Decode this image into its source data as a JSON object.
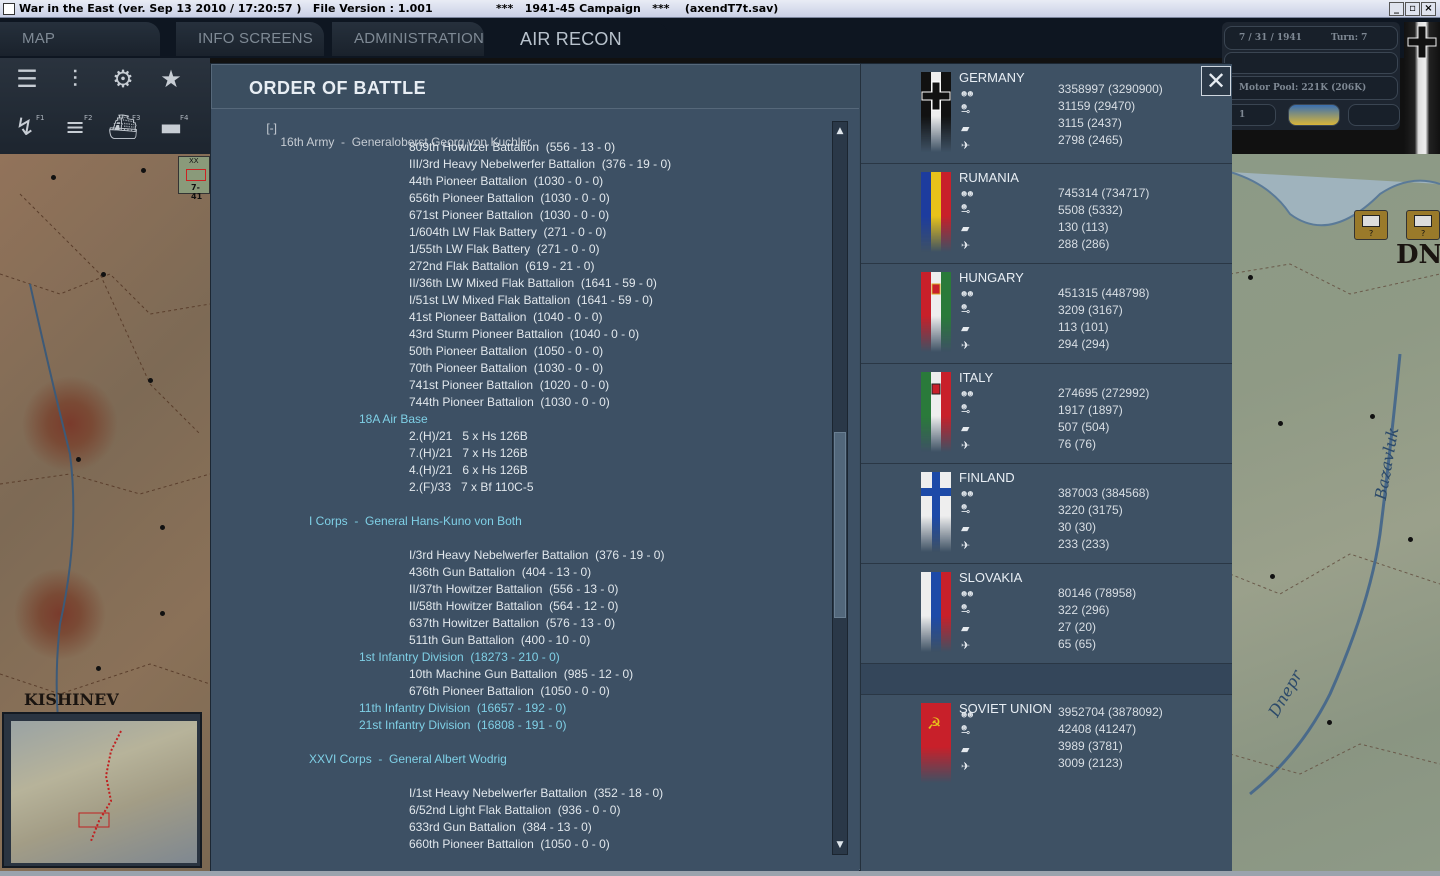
{
  "window": {
    "title_left": "War in the East (ver. Sep 13 2010 / 17:20:57 )   File Version : 1.001",
    "title_mid": "***   1941-45 Campaign   ***    (axendT7t.sav)"
  },
  "menu": {
    "tabs": [
      "MAP INFORMATION",
      "INFO SCREENS",
      "ADMINISTRATION",
      "AIR RECON"
    ]
  },
  "status": {
    "date": "7 / 31 / 1941",
    "turn": "Turn: 7",
    "motor_pool": "Motor Pool:  221K (206K)",
    "small_value": "1"
  },
  "toolbar": {
    "fkeys": [
      "F1",
      "F2",
      "F3",
      "F4"
    ]
  },
  "map": {
    "city_left": "KISHINEV",
    "city_right": "DN",
    "river1": "Bazavluk",
    "river2": "Dnepr",
    "unit_counter": "7-41",
    "unit_counter_type": "XX",
    "marker_label": "?"
  },
  "dialog": {
    "title": "ORDER OF BATTLE",
    "close_label": "✕",
    "tree_toggle": "[-]",
    "army_header": "16th Army  -  Generaloberst Georg von Kuchler"
  },
  "oob_rows": [
    {
      "text": "809th Howitzer Battalion  (556 - 13 - 0)",
      "level": 3
    },
    {
      "text": "III/3rd Heavy Nebelwerfer Battalion  (376 - 19 - 0)",
      "level": 3
    },
    {
      "text": "44th Pioneer Battalion  (1030 - 0 - 0)",
      "level": 3
    },
    {
      "text": "656th Pioneer Battalion  (1030 - 0 - 0)",
      "level": 3
    },
    {
      "text": "671st Pioneer Battalion  (1030 - 0 - 0)",
      "level": 3
    },
    {
      "text": "1/604th LW Flak Battery  (271 - 0 - 0)",
      "level": 3
    },
    {
      "text": "1/55th LW Flak Battery  (271 - 0 - 0)",
      "level": 3
    },
    {
      "text": "272nd Flak Battalion  (619 - 21 - 0)",
      "level": 3
    },
    {
      "text": "II/36th LW Mixed Flak Battalion  (1641 - 59 - 0)",
      "level": 3
    },
    {
      "text": "I/51st LW Mixed Flak Battalion  (1641 - 59 - 0)",
      "level": 3
    },
    {
      "text": "41st Pioneer Battalion  (1040 - 0 - 0)",
      "level": 3
    },
    {
      "text": "43rd Sturm Pioneer Battalion  (1040 - 0 - 0)",
      "level": 3
    },
    {
      "text": "50th Pioneer Battalion  (1050 - 0 - 0)",
      "level": 3
    },
    {
      "text": "70th Pioneer Battalion  (1030 - 0 - 0)",
      "level": 3
    },
    {
      "text": "741st Pioneer Battalion  (1020 - 0 - 0)",
      "level": 3
    },
    {
      "text": "744th Pioneer Battalion  (1030 - 0 - 0)",
      "level": 3
    },
    {
      "text": "18A Air Base",
      "level": 2,
      "hq": true
    },
    {
      "text": "2.(H)/21   5 x Hs 126B",
      "level": 3
    },
    {
      "text": "7.(H)/21   7 x Hs 126B",
      "level": 3
    },
    {
      "text": "4.(H)/21   6 x Hs 126B",
      "level": 3
    },
    {
      "text": "2.(F)/33   7 x Bf 110C-5",
      "level": 3
    },
    {
      "text": "",
      "level": 0
    },
    {
      "text": "I Corps  -  General Hans-Kuno von Both",
      "level": 1,
      "hq": true
    },
    {
      "text": "",
      "level": 0
    },
    {
      "text": "I/3rd Heavy Nebelwerfer Battalion  (376 - 19 - 0)",
      "level": 3
    },
    {
      "text": "436th Gun Battalion  (404 - 13 - 0)",
      "level": 3
    },
    {
      "text": "II/37th Howitzer Battalion  (556 - 13 - 0)",
      "level": 3
    },
    {
      "text": "II/58th Howitzer Battalion  (564 - 12 - 0)",
      "level": 3
    },
    {
      "text": "637th Howitzer Battalion  (576 - 13 - 0)",
      "level": 3
    },
    {
      "text": "511th Gun Battalion  (400 - 10 - 0)",
      "level": 3
    },
    {
      "text": "1st Infantry Division  (18273 - 210 - 0)",
      "level": 2,
      "hq": true
    },
    {
      "text": "10th Machine Gun Battalion  (985 - 12 - 0)",
      "level": 3
    },
    {
      "text": "676th Pioneer Battalion  (1050 - 0 - 0)",
      "level": 3
    },
    {
      "text": "11th Infantry Division  (16657 - 192 - 0)",
      "level": 2,
      "hq": true
    },
    {
      "text": "21st Infantry Division  (16808 - 191 - 0)",
      "level": 2,
      "hq": true
    },
    {
      "text": "",
      "level": 0
    },
    {
      "text": "XXVI Corps  -  General Albert Wodrig",
      "level": 1,
      "hq": true
    },
    {
      "text": "",
      "level": 0
    },
    {
      "text": "I/1st Heavy Nebelwerfer Battalion  (352 - 18 - 0)",
      "level": 3
    },
    {
      "text": "6/52nd Light Flak Battalion  (936 - 0 - 0)",
      "level": 3
    },
    {
      "text": "633rd Gun Battalion  (384 - 13 - 0)",
      "level": 3
    },
    {
      "text": "660th Pioneer Battalion  (1050 - 0 - 0)",
      "level": 3
    }
  ],
  "nations": [
    {
      "name": "GERMANY",
      "flag": "germany",
      "values": [
        "3358997 (3290900)",
        "31159 (29470)",
        "3115 (2437)",
        "2798 (2465)"
      ]
    },
    {
      "name": "RUMANIA",
      "flag": "rumania",
      "values": [
        "745314 (734717)",
        "5508 (5332)",
        "130 (113)",
        "288 (286)"
      ]
    },
    {
      "name": "HUNGARY",
      "flag": "hungary",
      "values": [
        "451315 (448798)",
        "3209 (3167)",
        "113 (101)",
        "294 (294)"
      ]
    },
    {
      "name": "ITALY",
      "flag": "italy",
      "values": [
        "274695 (272992)",
        "1917 (1897)",
        "507 (504)",
        "76 (76)"
      ]
    },
    {
      "name": "FINLAND",
      "flag": "finland",
      "values": [
        "387003 (384568)",
        "3220 (3175)",
        "30 (30)",
        "233 (233)"
      ]
    },
    {
      "name": "SLOVAKIA",
      "flag": "slovakia",
      "values": [
        "80146 (78958)",
        "322 (296)",
        "27 (20)",
        "65 (65)"
      ]
    },
    {
      "name": "SOVIET UNION",
      "flag": "soviet",
      "values": [
        "3952704 (3878092)",
        "42408 (41247)",
        "3989 (3781)",
        "3009 (2123)"
      ]
    }
  ],
  "icons": {
    "manpower": "men-icon",
    "guns": "gun-icon",
    "afv": "tank-icon",
    "aircraft": "plane-icon"
  },
  "colors": {
    "dialog_bg": "#3b4e60",
    "hq_text": "#7fd0e6",
    "unit_text": "#e1e7ec"
  }
}
